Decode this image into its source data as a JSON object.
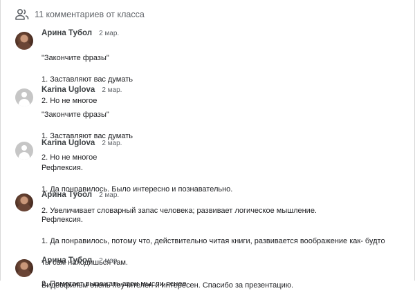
{
  "header": {
    "count_label": "11 комментариев от класса",
    "icon": "people-icon"
  },
  "comments": [
    {
      "author": "Арина Тубол",
      "date": "2 мар.",
      "avatar": "photo",
      "lines": [
        "\"Закончите фразы\"",
        "1. Заставляют вас думать",
        "2. Но не многое"
      ]
    },
    {
      "author": "Karina Uglova",
      "date": "2 мар.",
      "avatar": "generic",
      "lines": [
        "\"Закончите фразы\"",
        "1. Заставляют вас думать",
        "2. Но не многое"
      ]
    },
    {
      "author": "Karina Uglova",
      "date": "2 мар.",
      "avatar": "generic",
      "lines": [
        "Рефлексия.",
        "1. Да понравилось. Было интересно и познавательно.",
        "2. Увеличивает словарный запас человека; развивает логическое мышление."
      ]
    },
    {
      "author": "Арина Тубол",
      "date": "2 мар.",
      "avatar": "photo",
      "lines": [
        "Рефлексия.",
        "1. Да понравилось, потому что, действительно читая книги, развивается воображение как- будто",
        "ты сам находишься там.",
        "2. Помогает выражать свои мысли яснее"
      ]
    },
    {
      "author": "Арина Тубол",
      "date": "2 мар.",
      "avatar": "photo",
      "lines": [
        "Видеофильм очень поучителен и интересен. Спасибо за презентацию."
      ]
    }
  ]
}
